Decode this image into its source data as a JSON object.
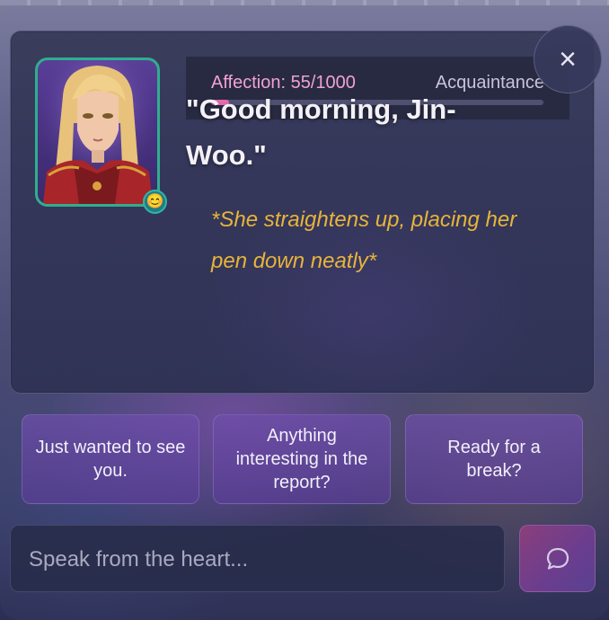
{
  "character": {
    "mood_emoji": "😊",
    "greeting": "\"Good morning, Jin-Woo.\"",
    "action": "*She straightens up, placing her pen down neatly*"
  },
  "affection": {
    "label": "Affection: 55/1000",
    "current": 55,
    "max": 1000,
    "stage": "Acquaintance",
    "fill_color": "#e76aab"
  },
  "close_icon": "×",
  "choices": [
    {
      "label": "Just wanted to see you."
    },
    {
      "label": "Anything interesting in the report?"
    },
    {
      "label": "Ready for a break?"
    }
  ],
  "input": {
    "placeholder": "Speak from the heart..."
  },
  "send_button": {
    "icon": "chat-bubble-icon"
  },
  "colors": {
    "accent_pink": "#f0a3d2",
    "action_text": "#e8b43a",
    "portrait_border": "#2fae8e"
  }
}
